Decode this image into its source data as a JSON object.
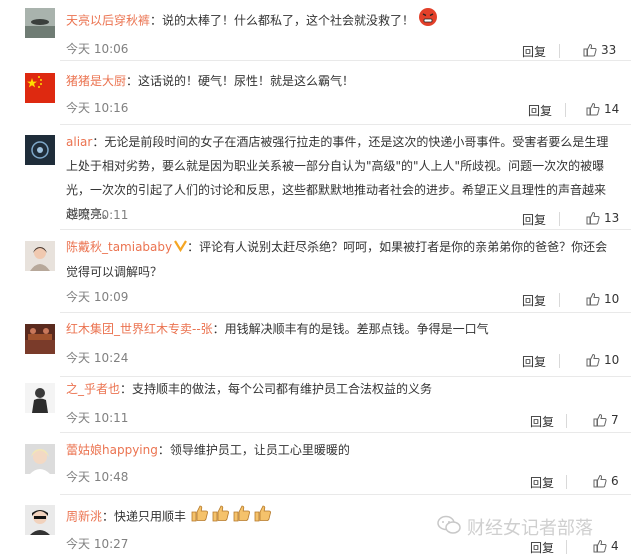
{
  "comments": [
    {
      "name": "天亮以后穿秋裤",
      "text": "：说的太棒了！什么都私了，这个社会就没救了！",
      "time": "今天 10:06",
      "reply": "回复",
      "likes": "33"
    },
    {
      "name": "猪猪是大厨",
      "text": "：这话说的！硬气！尿性！就是这么霸气！",
      "time": "今天 10:16",
      "reply": "回复",
      "likes": "14"
    },
    {
      "name": "aliar",
      "text": "：无论是前段时间的女子在酒店被强行拉走的事件，还是这次的快递小哥事件。受害者要么是生理上处于相对劣势，要么就是因为职业关系被一部分自认为\"高级\"的\"人上人\"所歧视。问题一次次的被曝光，一次次的引起了人们的讨论和反思，这些都默默地推动者社会的进步。希望正义且理性的声音越来越嘹亮。",
      "time": "今天 10:11",
      "reply": "回复",
      "likes": "13"
    },
    {
      "name": "陈戴秋_tamiababy",
      "text": "：评论有人说别太赶尽杀绝？呵呵，如果被打者是你的亲弟弟你的爸爸？你还会觉得可以调解吗？",
      "time": "今天 10:09",
      "reply": "回复",
      "likes": "10"
    },
    {
      "name": "红木集团_世界红木专卖--张",
      "text": "：用钱解决顺丰有的是钱。差那点钱。争得是一口气",
      "time": "今天 10:24",
      "reply": "回复",
      "likes": "10"
    },
    {
      "name": "之_乎者也",
      "text": "：支持顺丰的做法，每个公司都有维护员工合法权益的义务",
      "time": "今天 10:11",
      "reply": "回复",
      "likes": "7"
    },
    {
      "name": "蕾姑娘happying",
      "text": "：领导维护员工，让员工心里暖暖的",
      "time": "今天 10:48",
      "reply": "回复",
      "likes": "6"
    },
    {
      "name": "周新洮",
      "text": "：快递只用顺丰",
      "time": "今天 10:27",
      "reply": "回复",
      "likes": "4"
    }
  ],
  "watermark": "财经女记者部落",
  "colors": {
    "name": "#eb7350",
    "time": "#808080",
    "divider": "#e9e9e9"
  }
}
